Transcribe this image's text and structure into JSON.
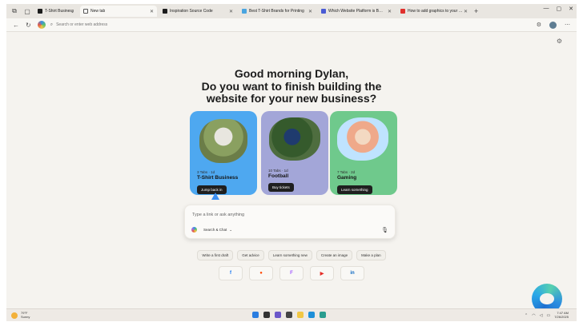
{
  "tabs": [
    {
      "label": "T-Shirt Business",
      "fav_color": "#1c1c1c",
      "active": false
    },
    {
      "label": "New tab",
      "fav_color": "#555555",
      "active": true
    },
    {
      "label": "Inspiration Source Code",
      "fav_color": "#1c1c1c",
      "active": false
    },
    {
      "label": "Best T-Shirt Brands for Printing",
      "fav_color": "#4aa5e0",
      "active": false
    },
    {
      "label": "Which Website Platform is Better fo...",
      "fav_color": "#4a5bd4",
      "active": false
    },
    {
      "label": "How to add graphics to your websi...",
      "fav_color": "#e0302c",
      "active": false
    }
  ],
  "address": {
    "placeholder": "Search or enter web address"
  },
  "greeting": {
    "line1": "Good morning Dylan,",
    "line2": "Do you want to finish building the",
    "line3": "website for your new business?"
  },
  "cards": [
    {
      "meta": "3 Tabs · 1d",
      "title": "T-Shirt Business",
      "button": "Jump back in"
    },
    {
      "meta": "10 Tabs · 1d",
      "title": "Football",
      "button": "Buy tickets"
    },
    {
      "meta": "7 Tabs · 2d",
      "title": "Gaming",
      "button": "Learn something"
    }
  ],
  "chat": {
    "placeholder": "Type a link or ask anything",
    "mode": "Search & Chat",
    "mode_caret": "⌄"
  },
  "suggestions": [
    "Write a first draft",
    "Get advice",
    "Learn something new",
    "Create an image",
    "Make a plan"
  ],
  "quicklinks": [
    {
      "glyph": "f",
      "color": "#1877f2"
    },
    {
      "glyph": "●",
      "color": "#ff4500"
    },
    {
      "glyph": "F",
      "color": "#a259ff"
    },
    {
      "glyph": "▶",
      "color": "#e52d27"
    },
    {
      "glyph": "in",
      "color": "#0a66c2"
    }
  ],
  "taskbar": {
    "weather_temp": "79°F",
    "weather_cond": "Sunny",
    "time": "7:47 AM",
    "date": "7/26/2025"
  }
}
